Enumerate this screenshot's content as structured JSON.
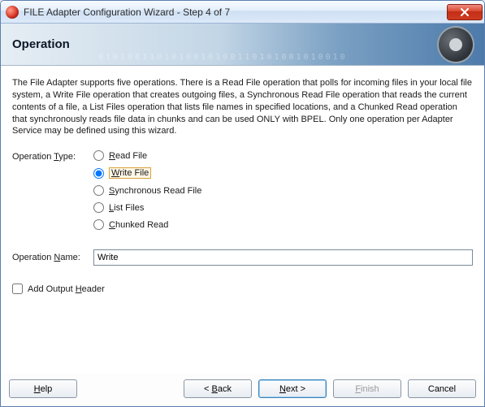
{
  "window": {
    "title": "FILE Adapter Configuration Wizard - Step 4 of 7"
  },
  "banner": {
    "heading": "Operation",
    "digits": "0101001101010010100110101001010010"
  },
  "intro": "The File Adapter supports five operations.  There is a Read File operation that polls for incoming files in your local file system, a Write File operation that creates outgoing files, a Synchronous Read File operation that reads the current contents of a file, a List Files operation that lists file names in specified locations, and a Chunked Read operation that synchronously reads file data in chunks and can be used ONLY with BPEL. Only one operation per Adapter Service may be defined using this wizard.",
  "labels": {
    "operation_type_prefix": "Operation ",
    "operation_type_ul": "T",
    "operation_type_suffix": "ype:",
    "operation_name_prefix": "Operation ",
    "operation_name_ul": "N",
    "operation_name_suffix": "ame:"
  },
  "options": {
    "read": "Read File",
    "write": "Write File",
    "sync": "Synchronous Read File",
    "list": "List Files",
    "chunk": "Chunked Read",
    "selected": "write"
  },
  "operation_name_value": "Write",
  "checkbox": {
    "prefix": "Add Output ",
    "ul": "H",
    "suffix": "eader"
  },
  "buttons": {
    "help_ul": "H",
    "help_rest": "elp",
    "back_prefix": "< ",
    "back_ul": "B",
    "back_rest": "ack",
    "next_ul": "N",
    "next_rest": "ext >",
    "finish_ul": "F",
    "finish_rest": "inish",
    "cancel": "Cancel"
  }
}
